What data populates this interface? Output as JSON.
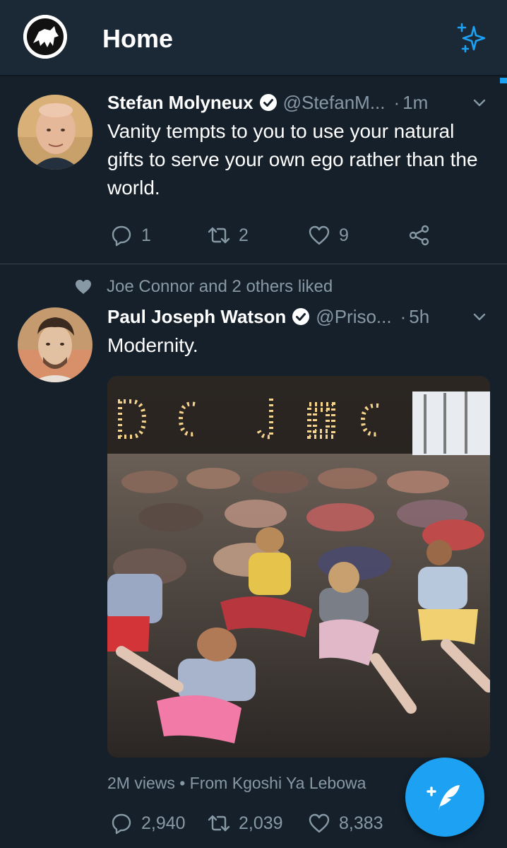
{
  "header": {
    "title": "Home",
    "logo_icon": "wolf-logo-icon",
    "sparkle_icon": "sparkle-icon",
    "accent": "#1da1f2"
  },
  "tweets": [
    {
      "name": "Stefan Molyneux",
      "handle": "@StefanM...",
      "time": "1m",
      "verified": true,
      "text": "Vanity tempts to you to use your natural gifts to serve your own ego rather than the world.",
      "replies": "1",
      "retweets": "2",
      "likes": "9"
    },
    {
      "social_context": "Joe Connor and 2 others liked",
      "name": "Paul Joseph Watson",
      "handle": "@Priso...",
      "time": "5h",
      "verified": true,
      "text": "Modernity.",
      "media_meta": "2M views • From Kgoshi Ya Lebowa",
      "replies": "2,940",
      "retweets": "2,039",
      "likes": "8,383"
    }
  ],
  "fab": {
    "icon": "compose-tweet-icon"
  },
  "colors": {
    "background": "#15202b",
    "header_bg": "#1b2836",
    "secondary_text": "#8899a6",
    "divider": "#38444d"
  }
}
